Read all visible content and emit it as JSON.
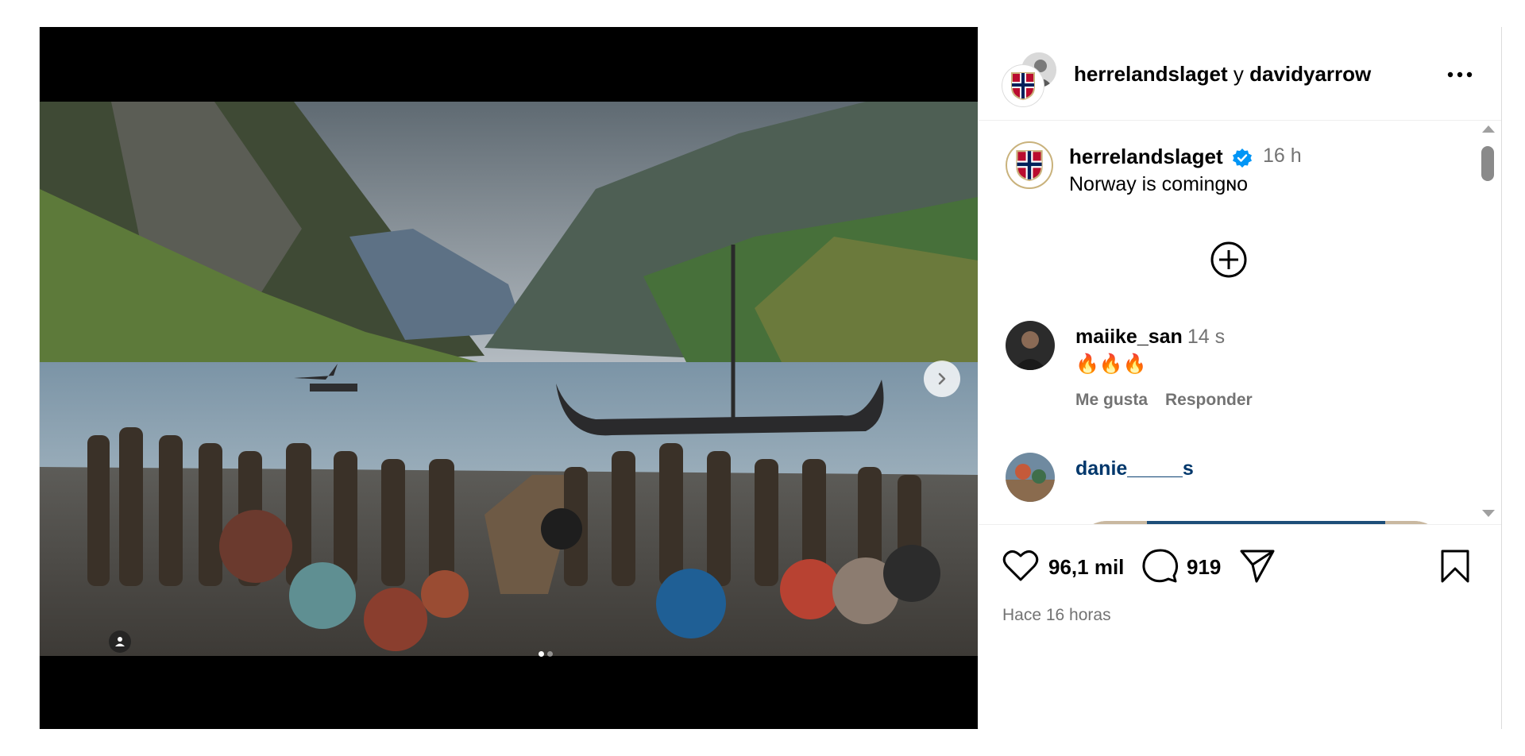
{
  "header": {
    "user1": "herrelandslaget",
    "conjunction": "y",
    "user2": "davidyarrow",
    "more_icon": "more-horizontal-icon"
  },
  "caption": {
    "username": "herrelandslaget",
    "time": "16 h",
    "text": "Norway is comingɴᴏ"
  },
  "comments": [
    {
      "username": "maiike_san",
      "time": "14 s",
      "text": "🔥🔥🔥",
      "like_label": "Me gusta",
      "reply_label": "Responder"
    },
    {
      "username": "danie_____s"
    }
  ],
  "actions": {
    "likes": "96,1 mil",
    "comments": "919",
    "time_ago": "Hace 16 horas"
  },
  "colors": {
    "verified": "#0095f6",
    "link": "#00376b",
    "muted": "#737373"
  }
}
